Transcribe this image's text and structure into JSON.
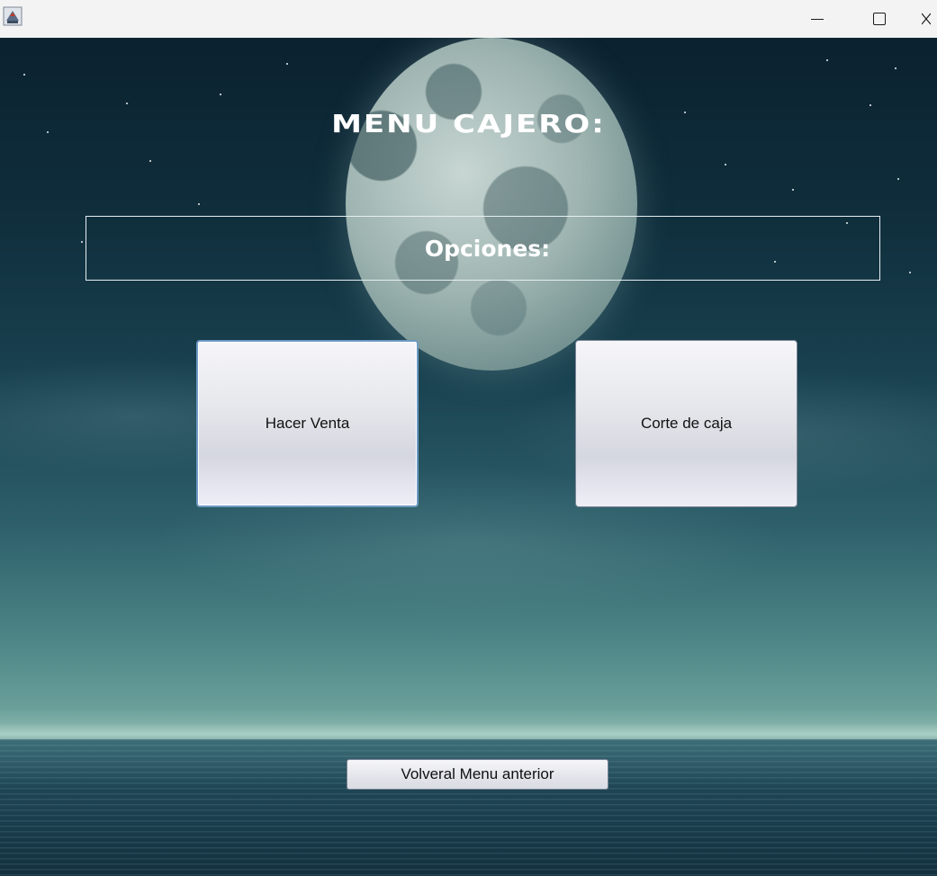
{
  "window": {
    "app_icon": "java-cup-icon",
    "controls": {
      "minimize_icon": "minimize-icon",
      "maximize_icon": "maximize-icon"
    }
  },
  "main": {
    "title": "MENU CAJERO:",
    "options_label": "Opciones:",
    "buttons": {
      "hacer_venta": "Hacer Venta",
      "corte_de_caja": "Corte de caja"
    },
    "back_button": "Volveral Menu anterior"
  },
  "colors": {
    "title_text": "#ffffff",
    "button_face": "#e6e7ec",
    "focus_border": "#6e9ac4",
    "titlebar_bg": "#f3f3f3"
  }
}
